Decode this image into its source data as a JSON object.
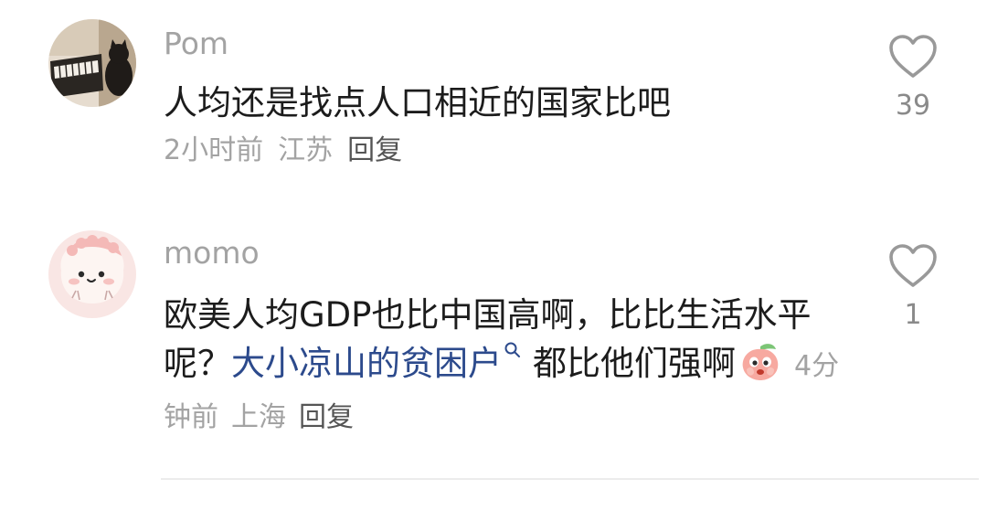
{
  "comments": [
    {
      "username": "Pom",
      "text": "人均还是找点人口相近的国家比吧",
      "time": "2小时前",
      "location": "江苏",
      "reply_label": "回复",
      "likes": "39",
      "avatar_icon": "piano-cat-avatar"
    },
    {
      "username": "momo",
      "text_before_link": "欧美人均GDP也比中国高啊，比比生活水平呢？",
      "link_text": "大小凉山的贫困户",
      "text_after_link": "都比他们强啊",
      "time": "4分钟前",
      "location": "上海",
      "reply_label": "回复",
      "likes": "1",
      "avatar_icon": "pink-cartoon-avatar",
      "emoji_icon": "peach-face-emoji"
    }
  ],
  "colors": {
    "username": "#a3a3a3",
    "text": "#1c1c1c",
    "link": "#2c4a8c",
    "meta": "#a3a3a3",
    "reply": "#555555",
    "heart": "#999999"
  }
}
